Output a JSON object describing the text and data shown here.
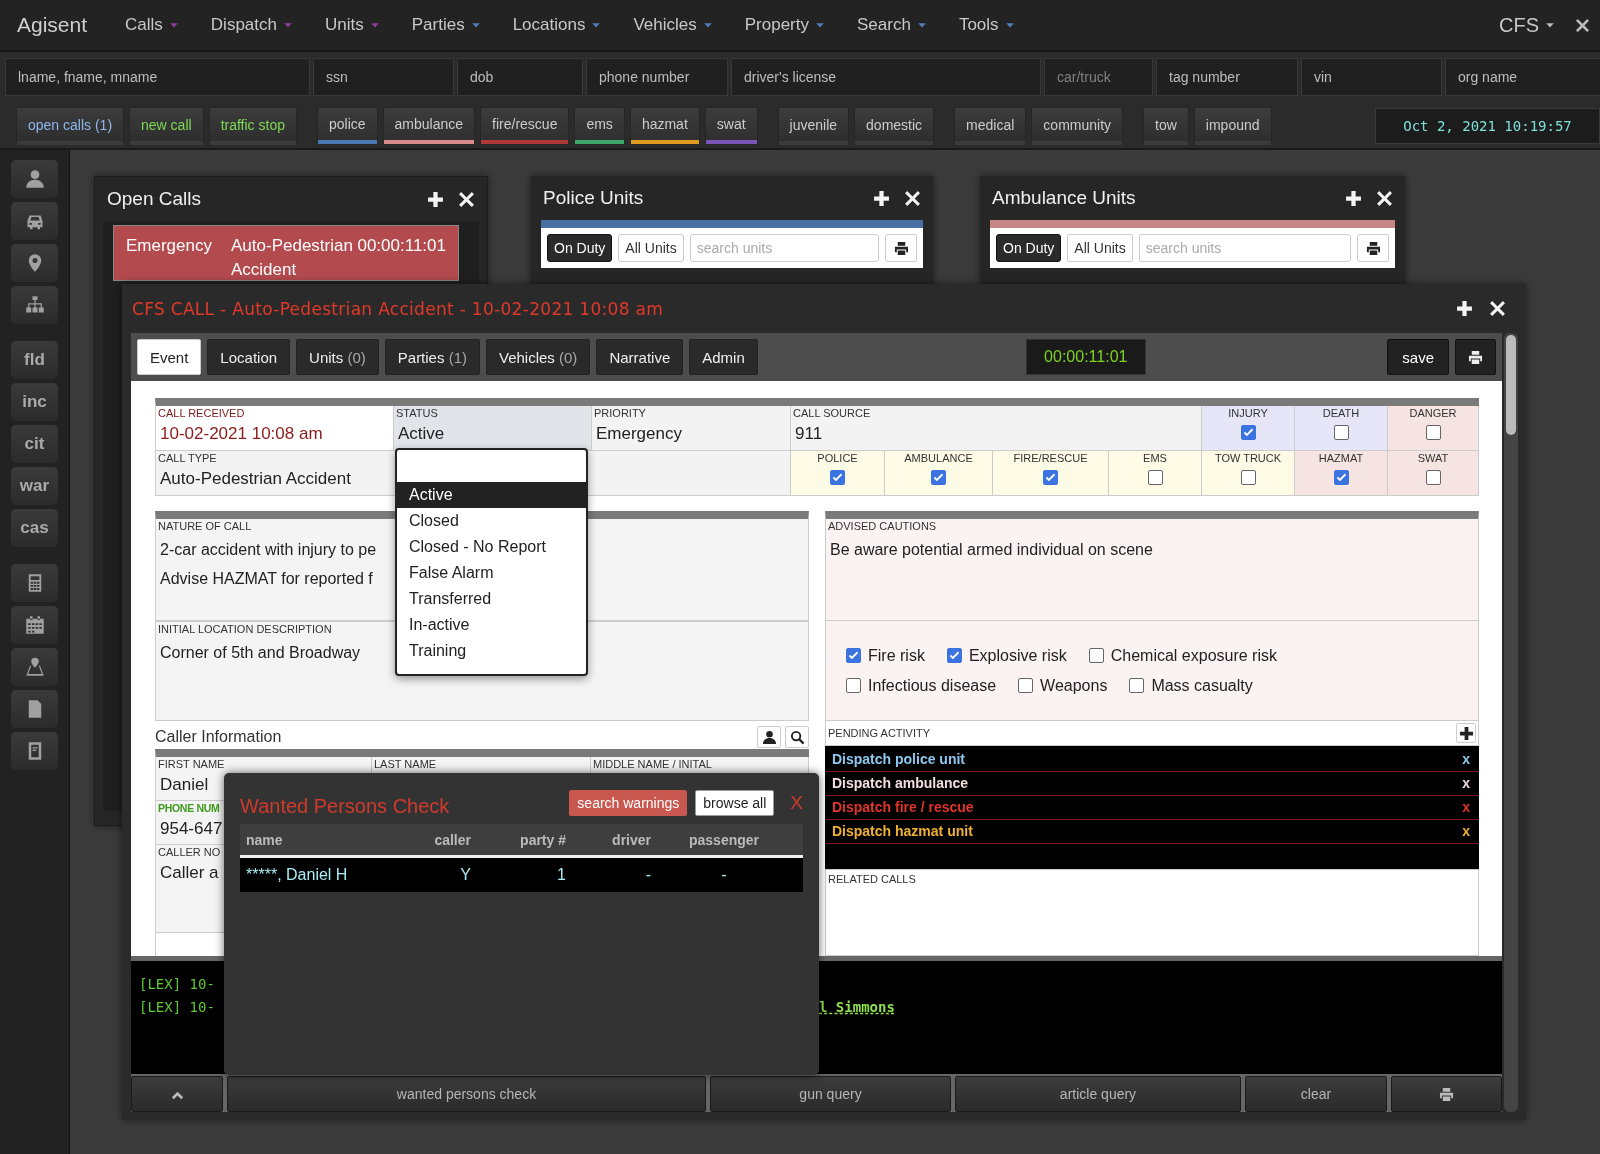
{
  "app": {
    "name": "Agisent",
    "mode": "CFS"
  },
  "menu": [
    {
      "label": "Calls",
      "color": "#8a3f9c"
    },
    {
      "label": "Dispatch",
      "color": "#8a3f9c"
    },
    {
      "label": "Units",
      "color": "#8a3f9c"
    },
    {
      "label": "Parties",
      "color": "#4f7fbf"
    },
    {
      "label": "Locations",
      "color": "#4f7fbf"
    },
    {
      "label": "Vehicles",
      "color": "#4f7fbf"
    },
    {
      "label": "Property",
      "color": "#4f7fbf"
    },
    {
      "label": "Search",
      "color": "#4f7fbf"
    },
    {
      "label": "Tools",
      "color": "#4f7fbf"
    }
  ],
  "search_fields": [
    {
      "placeholder": "lname, fname, mname",
      "disabled": false
    },
    {
      "placeholder": "ssn",
      "disabled": false
    },
    {
      "placeholder": "dob",
      "disabled": false
    },
    {
      "placeholder": "phone number",
      "disabled": false
    },
    {
      "placeholder": "driver's license",
      "disabled": false
    },
    {
      "placeholder": "car/truck",
      "disabled": true
    },
    {
      "placeholder": "tag number",
      "disabled": false
    },
    {
      "placeholder": "vin",
      "disabled": false
    },
    {
      "placeholder": "org name",
      "disabled": false
    }
  ],
  "quick_buttons": [
    [
      {
        "label": "open calls (1)",
        "kind": "text",
        "color": "#8fb8ee"
      },
      {
        "label": "new call",
        "kind": "text",
        "color": "#7ed957"
      },
      {
        "label": "traffic stop",
        "kind": "text",
        "color": "#7ed957"
      }
    ],
    [
      {
        "label": "police",
        "kind": "underline",
        "color": "#4a78b5"
      },
      {
        "label": "ambulance",
        "kind": "underline",
        "color": "#d98a8a"
      },
      {
        "label": "fire/rescue",
        "kind": "underline",
        "color": "#b03a3a"
      },
      {
        "label": "ems",
        "kind": "underline",
        "color": "#3fa66a"
      },
      {
        "label": "hazmat",
        "kind": "underline",
        "color": "#e09a20"
      },
      {
        "label": "swat",
        "kind": "underline",
        "color": "#7a55b5"
      }
    ],
    [
      {
        "label": "juvenile",
        "kind": "plain"
      },
      {
        "label": "domestic",
        "kind": "plain"
      }
    ],
    [
      {
        "label": "medical",
        "kind": "plain"
      },
      {
        "label": "community",
        "kind": "plain"
      }
    ],
    [
      {
        "label": "tow",
        "kind": "plain"
      },
      {
        "label": "impound",
        "kind": "plain"
      }
    ]
  ],
  "clock": "Oct 2, 2021 10:19:57",
  "sidebar": {
    "text_buttons": [
      "fld",
      "inc",
      "cit",
      "war",
      "cas"
    ]
  },
  "open_calls": {
    "title": "Open Calls",
    "calls": [
      {
        "priority": "Emergency",
        "type": "Auto-Pedestrian Accident",
        "elapsed": "00:00:11:01"
      }
    ]
  },
  "unit_panels": [
    {
      "title": "Police Units",
      "color": "#4a6fa5",
      "filters": [
        {
          "label": "On Duty",
          "selected": true
        },
        {
          "label": "All Units",
          "selected": false
        }
      ],
      "search_placeholder": "search units"
    },
    {
      "title": "Ambulance Units",
      "color": "#c98585",
      "filters": [
        {
          "label": "On Duty",
          "selected": true
        },
        {
          "label": "All Units",
          "selected": false
        }
      ],
      "search_placeholder": "search units"
    }
  ],
  "cfs": {
    "title": "CFS CALL - Auto-Pedestrian Accident - 10-02-2021 10:08 am",
    "tabs": [
      {
        "label": "Event",
        "selected": true
      },
      {
        "label": "Location",
        "selected": false
      },
      {
        "label": "Units",
        "count": "(0)",
        "selected": false
      },
      {
        "label": "Parties",
        "count": "(1)",
        "selected": false
      },
      {
        "label": "Vehicles",
        "count": "(0)",
        "selected": false
      },
      {
        "label": "Narrative",
        "selected": false
      },
      {
        "label": "Admin",
        "selected": false
      }
    ],
    "timer": "00:00:11:01",
    "save": "save",
    "call_received": {
      "label": "CALL RECEIVED",
      "value": "10-02-2021 10:08 am"
    },
    "status": {
      "label": "STATUS",
      "value": "Active"
    },
    "priority": {
      "label": "PRIORITY",
      "value": "Emergency"
    },
    "call_source": {
      "label": "CALL SOURCE",
      "value": "911"
    },
    "call_type": {
      "label": "CALL TYPE",
      "value": "Auto-Pedestrian Accident"
    },
    "flags": [
      {
        "label": "INJURY",
        "checked": true,
        "color": "#e6e6f8"
      },
      {
        "label": "DEATH",
        "checked": false,
        "color": "#e6e6f8"
      },
      {
        "label": "DANGER",
        "checked": false,
        "color": "#f6e4e2"
      }
    ],
    "services": [
      {
        "label": "POLICE",
        "checked": true,
        "color": "#fdfbe6"
      },
      {
        "label": "AMBULANCE",
        "checked": true,
        "color": "#fdfbe6"
      },
      {
        "label": "FIRE/RESCUE",
        "checked": true,
        "color": "#fdfbe6"
      },
      {
        "label": "EMS",
        "checked": false,
        "color": "#fdfbe6"
      },
      {
        "label": "TOW TRUCK",
        "checked": false,
        "color": "#fdfbe6"
      },
      {
        "label": "HAZMAT",
        "checked": true,
        "color": "#f6e4e2"
      },
      {
        "label": "SWAT",
        "checked": false,
        "color": "#f6e4e2"
      }
    ],
    "status_options": [
      {
        "label": "Active",
        "selected": true
      },
      {
        "label": "Closed",
        "selected": false
      },
      {
        "label": "Closed - No Report",
        "selected": false
      },
      {
        "label": "False Alarm",
        "selected": false
      },
      {
        "label": "Transferred",
        "selected": false
      },
      {
        "label": "In-active",
        "selected": false
      },
      {
        "label": "Training",
        "selected": false
      }
    ],
    "nature_of_call": {
      "label": "NATURE OF CALL",
      "lines": [
        "2-car accident with injury to pe",
        "Advise HAZMAT for reported f"
      ]
    },
    "initial_location": {
      "label": "INITIAL LOCATION DESCRIPTION",
      "value": "Corner of 5th and Broadway"
    },
    "caller_info": {
      "title": "Caller Information",
      "rows": [
        [
          {
            "label": "FIRST NAME",
            "value": "Daniel"
          },
          {
            "label": "LAST NAME"
          },
          {
            "label": "MIDDLE NAME / INITAL"
          }
        ],
        [
          {
            "label": "PHONE NUM",
            "value": "954-647",
            "required": true
          }
        ],
        [
          {
            "label": "CALLER NO",
            "value": "Caller a",
            "required": false
          }
        ]
      ]
    },
    "advised_cautions": {
      "label": "ADVISED CAUTIONS",
      "value": "Be aware potential armed individual on scene"
    },
    "risk_rows": [
      [
        {
          "label": "Fire risk",
          "checked": true
        },
        {
          "label": "Explosive risk",
          "checked": true
        },
        {
          "label": "Chemical exposure risk",
          "checked": false
        }
      ],
      [
        {
          "label": "Infectious disease",
          "checked": false
        },
        {
          "label": "Weapons",
          "checked": false
        },
        {
          "label": "Mass casualty",
          "checked": false
        }
      ]
    ],
    "pending_activity": {
      "label": "PENDING ACTIVITY",
      "items": [
        {
          "text": "Dispatch police unit",
          "remove": "x",
          "color": "#8cc8f0"
        },
        {
          "text": "Dispatch ambulance",
          "remove": "x",
          "color": "#f2dede"
        },
        {
          "text": "Dispatch fire / rescue",
          "remove": "x",
          "color": "#e2352a"
        },
        {
          "text": "Dispatch hazmat unit",
          "remove": "x",
          "color": "#f0b030"
        }
      ]
    },
    "related_calls": {
      "label": "RELATED CALLS"
    },
    "console": [
      {
        "prefix": "[LEX] 10-"
      },
      {
        "prefix": "[LEX] 10-",
        "link": "l Simmons"
      }
    ],
    "console_buttons": [
      {
        "kind": "up"
      },
      {
        "kind": "text",
        "label": "wanted persons check"
      },
      {
        "kind": "text",
        "label": "gun query"
      },
      {
        "kind": "text",
        "label": "article query"
      },
      {
        "kind": "text",
        "label": "clear"
      },
      {
        "kind": "print"
      }
    ]
  },
  "wanted_check": {
    "title": "Wanted Persons Check",
    "buttons": [
      {
        "label": "search warnings",
        "kind": "primary"
      },
      {
        "label": "browse all",
        "kind": "secondary"
      }
    ],
    "close": "X",
    "columns": [
      "name",
      "caller",
      "party #",
      "driver",
      "passenger"
    ],
    "rows": [
      [
        "*****, Daniel H",
        "Y",
        "1",
        "-",
        "-"
      ]
    ]
  }
}
